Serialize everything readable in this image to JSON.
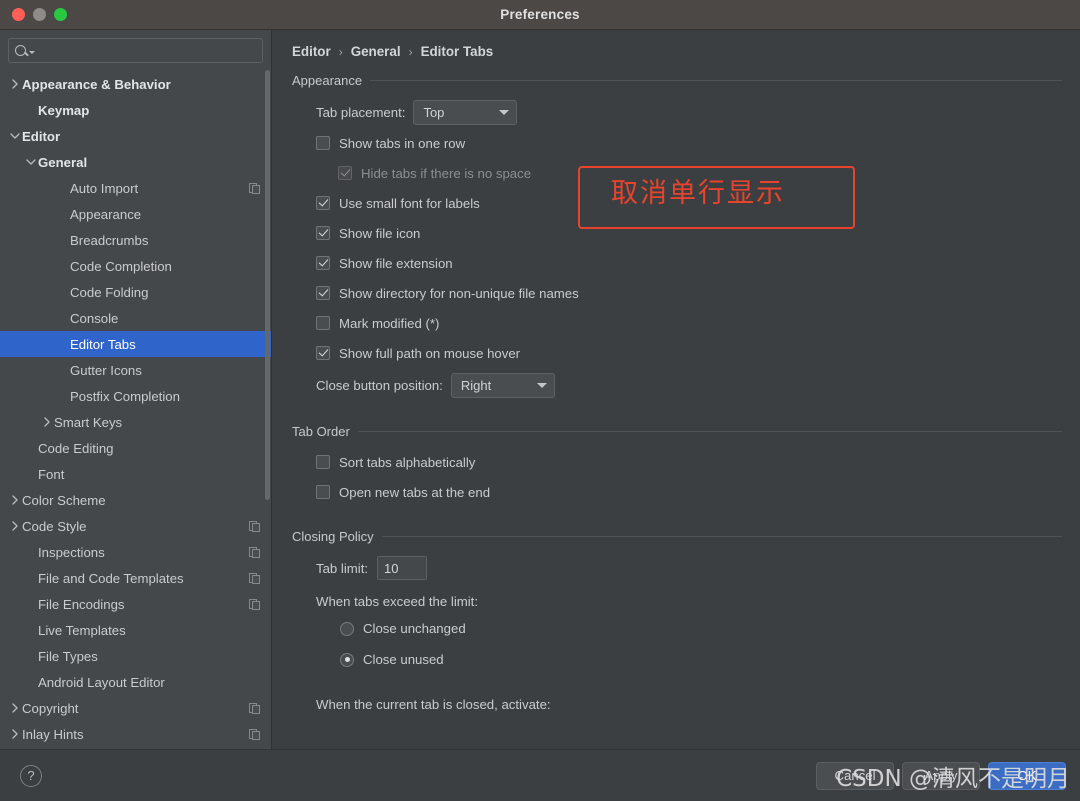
{
  "window": {
    "title": "Preferences",
    "traffic_lights": [
      "close-button",
      "minimize-button",
      "maximize-button"
    ]
  },
  "sidebar": {
    "search": {
      "value": "",
      "placeholder": ""
    },
    "items": [
      {
        "label": "Appearance & Behavior",
        "indent": 0,
        "arrow": "right",
        "bold": true,
        "copy": false,
        "selected": false
      },
      {
        "label": "Keymap",
        "indent": 1,
        "arrow": "none",
        "bold": true,
        "copy": false,
        "selected": false
      },
      {
        "label": "Editor",
        "indent": 0,
        "arrow": "down",
        "bold": true,
        "copy": false,
        "selected": false
      },
      {
        "label": "General",
        "indent": 1,
        "arrow": "down",
        "bold": true,
        "copy": false,
        "selected": false
      },
      {
        "label": "Auto Import",
        "indent": 3,
        "arrow": "none",
        "bold": false,
        "copy": true,
        "selected": false
      },
      {
        "label": "Appearance",
        "indent": 3,
        "arrow": "none",
        "bold": false,
        "copy": false,
        "selected": false
      },
      {
        "label": "Breadcrumbs",
        "indent": 3,
        "arrow": "none",
        "bold": false,
        "copy": false,
        "selected": false
      },
      {
        "label": "Code Completion",
        "indent": 3,
        "arrow": "none",
        "bold": false,
        "copy": false,
        "selected": false
      },
      {
        "label": "Code Folding",
        "indent": 3,
        "arrow": "none",
        "bold": false,
        "copy": false,
        "selected": false
      },
      {
        "label": "Console",
        "indent": 3,
        "arrow": "none",
        "bold": false,
        "copy": false,
        "selected": false
      },
      {
        "label": "Editor Tabs",
        "indent": 3,
        "arrow": "none",
        "bold": false,
        "copy": false,
        "selected": true
      },
      {
        "label": "Gutter Icons",
        "indent": 3,
        "arrow": "none",
        "bold": false,
        "copy": false,
        "selected": false
      },
      {
        "label": "Postfix Completion",
        "indent": 3,
        "arrow": "none",
        "bold": false,
        "copy": false,
        "selected": false
      },
      {
        "label": "Smart Keys",
        "indent": 2,
        "arrow": "right",
        "bold": false,
        "copy": false,
        "selected": false
      },
      {
        "label": "Code Editing",
        "indent": 1,
        "arrow": "none",
        "bold": false,
        "copy": false,
        "selected": false
      },
      {
        "label": "Font",
        "indent": 1,
        "arrow": "none",
        "bold": false,
        "copy": false,
        "selected": false
      },
      {
        "label": "Color Scheme",
        "indent": 0,
        "arrow": "right",
        "bold": false,
        "copy": false,
        "selected": false
      },
      {
        "label": "Code Style",
        "indent": 0,
        "arrow": "right",
        "bold": false,
        "copy": true,
        "selected": false
      },
      {
        "label": "Inspections",
        "indent": 1,
        "arrow": "none",
        "bold": false,
        "copy": true,
        "selected": false
      },
      {
        "label": "File and Code Templates",
        "indent": 1,
        "arrow": "none",
        "bold": false,
        "copy": true,
        "selected": false
      },
      {
        "label": "File Encodings",
        "indent": 1,
        "arrow": "none",
        "bold": false,
        "copy": true,
        "selected": false
      },
      {
        "label": "Live Templates",
        "indent": 1,
        "arrow": "none",
        "bold": false,
        "copy": false,
        "selected": false
      },
      {
        "label": "File Types",
        "indent": 1,
        "arrow": "none",
        "bold": false,
        "copy": false,
        "selected": false
      },
      {
        "label": "Android Layout Editor",
        "indent": 1,
        "arrow": "none",
        "bold": false,
        "copy": false,
        "selected": false
      },
      {
        "label": "Copyright",
        "indent": 0,
        "arrow": "right",
        "bold": false,
        "copy": true,
        "selected": false
      },
      {
        "label": "Inlay Hints",
        "indent": 0,
        "arrow": "right",
        "bold": false,
        "copy": true,
        "selected": false
      }
    ]
  },
  "breadcrumb": {
    "part1": "Editor",
    "sep1": "›",
    "part2": "General",
    "sep2": "›",
    "part3": "Editor Tabs"
  },
  "appearance": {
    "group_title": "Appearance",
    "tab_placement_label": "Tab placement:",
    "tab_placement_value": "Top",
    "checkboxes": [
      {
        "label": "Show tabs in one row",
        "checked": false,
        "disabled": false,
        "sub": false
      },
      {
        "label": "Hide tabs if there is no space",
        "checked": true,
        "disabled": true,
        "sub": true
      },
      {
        "label": "Use small font for labels",
        "checked": true,
        "disabled": false,
        "sub": false
      },
      {
        "label": "Show file icon",
        "checked": true,
        "disabled": false,
        "sub": false
      },
      {
        "label": "Show file extension",
        "checked": true,
        "disabled": false,
        "sub": false
      },
      {
        "label": "Show directory for non-unique file names",
        "checked": true,
        "disabled": false,
        "sub": false
      },
      {
        "label": "Mark modified (*)",
        "checked": false,
        "disabled": false,
        "sub": false
      },
      {
        "label": "Show full path on mouse hover",
        "checked": true,
        "disabled": false,
        "sub": false
      }
    ],
    "close_button_label": "Close button position:",
    "close_button_value": "Right"
  },
  "tab_order": {
    "group_title": "Tab Order",
    "checkboxes": [
      {
        "label": "Sort tabs alphabetically",
        "checked": false
      },
      {
        "label": "Open new tabs at the end",
        "checked": false
      }
    ]
  },
  "closing_policy": {
    "group_title": "Closing Policy",
    "tab_limit_label": "Tab limit:",
    "tab_limit_value": "10",
    "exceed_label": "When tabs exceed the limit:",
    "radios": [
      {
        "label": "Close unchanged",
        "selected": false
      },
      {
        "label": "Close unused",
        "selected": true
      }
    ],
    "closed_activate_label": "When the current tab is closed, activate:"
  },
  "annotation": {
    "text": "取消单行显示",
    "color": "#e8432c"
  },
  "footer": {
    "help_glyph": "?",
    "cancel_label": "Cancel",
    "apply_label": "Apply",
    "ok_label": "OK"
  },
  "watermark": {
    "text": "CSDN @清风不是明月"
  }
}
